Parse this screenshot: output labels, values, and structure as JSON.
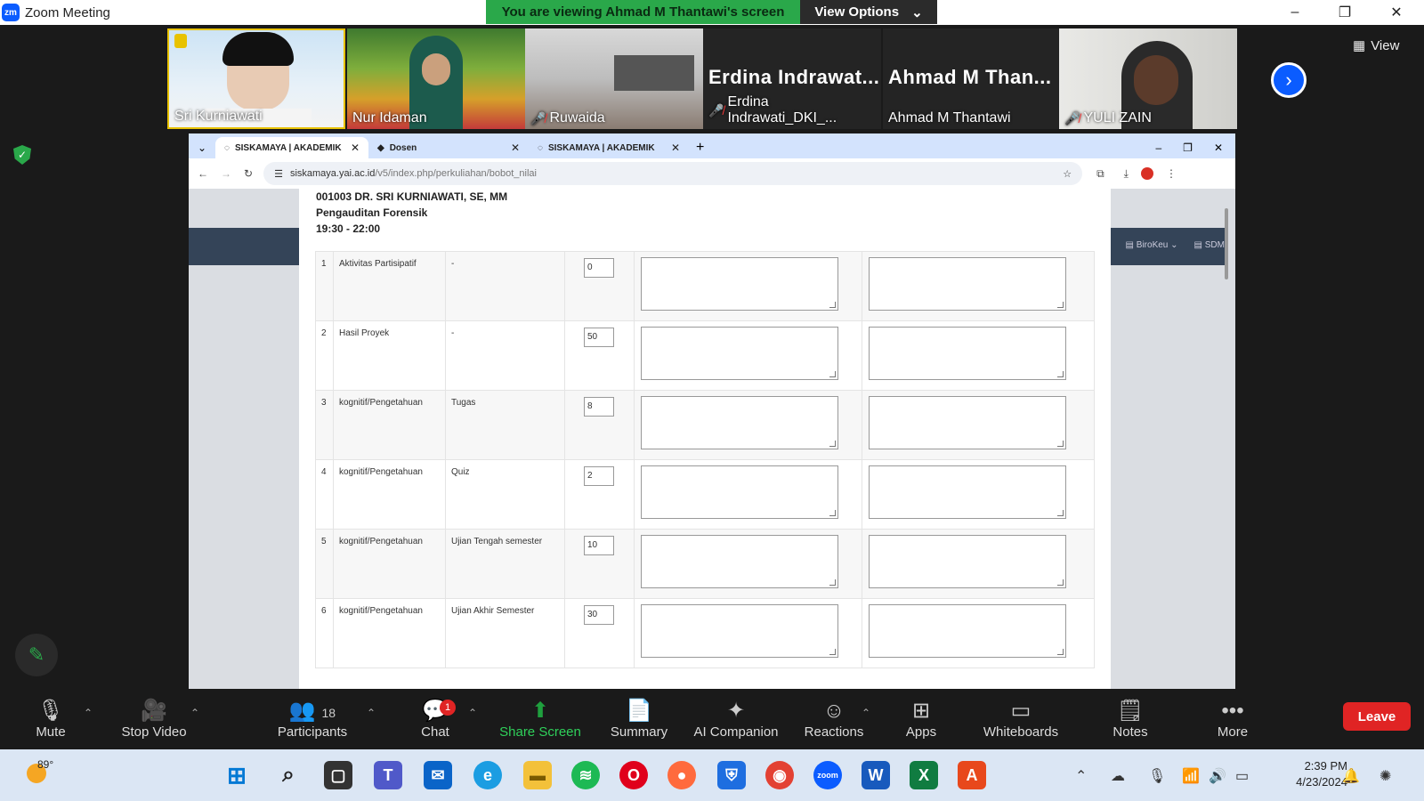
{
  "window": {
    "logo": "zm",
    "title": "Zoom Meeting",
    "minimize": "–",
    "restore": "❐",
    "close": "✕"
  },
  "banner": {
    "text": "You are viewing Ahmad M Thantawi's screen",
    "view_options": "View Options"
  },
  "participants_strip": [
    {
      "name": "Sri Kurniawati",
      "video": true,
      "muted": false
    },
    {
      "name": "Nur Idaman",
      "video": true,
      "muted": false
    },
    {
      "name": "Ruwaida",
      "video": true,
      "muted": true
    },
    {
      "name": "Erdina Indrawati_DKI_...",
      "big_label": "Erdina Indrawat...",
      "video": false,
      "muted": true
    },
    {
      "name": "Ahmad M Thantawi",
      "big_label": "Ahmad M Than...",
      "video": false,
      "muted": false
    },
    {
      "name": "YULI ZAIN",
      "video": true,
      "muted": true
    }
  ],
  "view_button": "View",
  "browser": {
    "tabs": [
      {
        "label": "SISKAMAYA | AKADEMIK",
        "active": true
      },
      {
        "label": "Dosen",
        "active": false
      },
      {
        "label": "SISKAMAYA | AKADEMIK",
        "active": false
      }
    ],
    "url_host": "siskamaya.yai.ac.id",
    "url_path": "/v5/index.php/perkuliahan/bobot_nilai",
    "nav_right": [
      "BiroKeu",
      "SDM"
    ]
  },
  "course": {
    "lecturer": "001003 DR. SRI KURNIAWATI, SE, MM",
    "subject": "Pengauditan Forensik",
    "time": "19:30 - 22:00"
  },
  "rows": [
    {
      "no": "1",
      "category": "Aktivitas Partisipatif",
      "component": "-",
      "value": "0"
    },
    {
      "no": "2",
      "category": "Hasil Proyek",
      "component": "-",
      "value": "50"
    },
    {
      "no": "3",
      "category": "kognitif/Pengetahuan",
      "component": "Tugas",
      "value": "8"
    },
    {
      "no": "4",
      "category": "kognitif/Pengetahuan",
      "component": "Quiz",
      "value": "2"
    },
    {
      "no": "5",
      "category": "kognitif/Pengetahuan",
      "component": "Ujian Tengah semester",
      "value": "10"
    },
    {
      "no": "6",
      "category": "kognitif/Pengetahuan",
      "component": "Ujian Akhir Semester",
      "value": "30"
    }
  ],
  "toolbar": {
    "mute": "Mute",
    "stop_video": "Stop Video",
    "participants": "Participants",
    "participants_count": "18",
    "chat": "Chat",
    "chat_badge": "1",
    "share_screen": "Share Screen",
    "summary": "Summary",
    "ai_companion": "AI Companion",
    "reactions": "Reactions",
    "apps": "Apps",
    "whiteboards": "Whiteboards",
    "notes": "Notes",
    "more": "More",
    "leave": "Leave"
  },
  "taskbar": {
    "temperature": "89°",
    "time": "2:39 PM",
    "date": "4/23/2024"
  },
  "colors": {
    "accent": "#0b5cff",
    "banner": "#2aa84a",
    "leave": "#e02424"
  }
}
